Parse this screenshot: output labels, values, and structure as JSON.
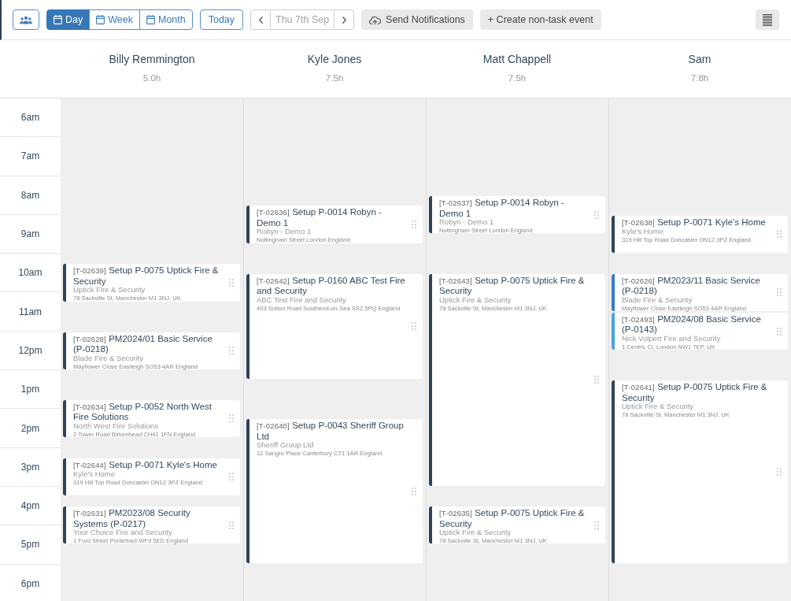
{
  "toolbar": {
    "view_tabs": [
      {
        "label": "Day",
        "selected": true
      },
      {
        "label": "Week",
        "selected": false
      },
      {
        "label": "Month",
        "selected": false
      }
    ],
    "today_button": "Today",
    "date": "Thu 7th Sep",
    "send_notifications_button": "Send Notifications",
    "create_event_button": "+ Create non-task event"
  },
  "time_slots": [
    "6am",
    "7am",
    "8am",
    "9am",
    "10am",
    "11am",
    "12pm",
    "1pm",
    "2pm",
    "3pm",
    "4pm",
    "5pm",
    "6pm"
  ],
  "resources": [
    {
      "name": "Billy Remmington",
      "hours": "5.0h",
      "events": [
        {
          "ref": "[T-02639]",
          "title": "Setup P-0075 Uptick Fire & Security",
          "client": "Uptick Fire & Security",
          "address": "78 Sackville St, Manchester M1 3NJ, UK",
          "color": "#2f4358"
        },
        {
          "ref": "[T-02628]",
          "title": "PM2024/01 Basic Service (P-0218)",
          "client": "Blade Fire & Security",
          "address": "Mayflower Close Eastleigh SO53 4AR England",
          "color": "#2f4358"
        },
        {
          "ref": "[T-02634]",
          "title": "Setup P-0052 North West Fire Solutions",
          "client": "North West Fire Solutions",
          "address": "2 Tower Road Birkenhead CH41 1FN England",
          "color": "#2f4358"
        },
        {
          "ref": "[T-02644]",
          "title": "Setup P-0071 Kyle's Home",
          "client": "Kyle's Home",
          "address": "319 Hill Top Road Doncaster DN12 3PZ England",
          "color": "#2f4358"
        },
        {
          "ref": "[T-02631]",
          "title": "PM2023/08 Security Systems (P-0217)",
          "client": "Your Choice Fire and Security",
          "address": "1 Ford Street Pontefract WF9 5ED England",
          "color": "#2f4358"
        }
      ]
    },
    {
      "name": "Kyle Jones",
      "hours": "7.5h",
      "events": [
        {
          "ref": "[T-02636]",
          "title": "Setup P-0014 Robyn - Demo 1",
          "client": "Robyn - Demo 1",
          "address": "Nottingham Street London England",
          "color": "#2f4358"
        },
        {
          "ref": "[T-02642]",
          "title": "Setup P-0160 ABC Test Fire and Security",
          "client": "ABC Test Fire and Security",
          "address": "403 Sutton Road Southend-on-Sea SS2 5PQ England",
          "color": "#2f4358"
        },
        {
          "ref": "[T-02640]",
          "title": "Setup P-0043 Sheriff Group Ltd",
          "client": "Sheriff Group Ltd",
          "address": "12 Sangro Place Canterbury CT1 1AR England",
          "color": "#2f4358"
        }
      ]
    },
    {
      "name": "Matt Chappell",
      "hours": "7.5h",
      "events": [
        {
          "ref": "[T-02637]",
          "title": "Setup P-0014 Robyn - Demo 1",
          "client": "Robyn - Demo 1",
          "address": "Nottingham Street London England",
          "color": "#2f4358"
        },
        {
          "ref": "[T-02643]",
          "title": "Setup P-0075 Uptick Fire & Security",
          "client": "Uptick Fire & Security",
          "address": "78 Sackville St, Manchester M1 3NJ, UK",
          "color": "#2f4358"
        },
        {
          "ref": "[T-02635]",
          "title": "Setup P-0075 Uptick Fire & Security",
          "client": "Uptick Fire & Security",
          "address": "78 Sackville St, Manchester M1 3NJ, UK",
          "color": "#2f4358"
        }
      ]
    },
    {
      "name": "Sam",
      "hours": "7.8h",
      "events": [
        {
          "ref": "[T-02638]",
          "title": "Setup P-0071 Kyle's Home",
          "client": "Kyle's Home",
          "address": "319 Hill Top Road Doncaster DN12 3PZ England",
          "color": "#2f4358"
        },
        {
          "ref": "[T-02626]",
          "title": "PM2023/11 Basic Service (P-0218)",
          "client": "Blade Fire & Security",
          "address": "Mayflower Close Eastleigh SO53 4AR England",
          "color": "#3a78d4"
        },
        {
          "ref": "[T-02493]",
          "title": "PM2024/08 Basic Service (P-0143)",
          "client": "Nick Volpert Fire and Security",
          "address": "1 Centric Cl, London NW1 7EP, UK",
          "color": "#4aa3e0"
        },
        {
          "ref": "[T-02641]",
          "title": "Setup P-0075 Uptick Fire & Security",
          "client": "Uptick Fire & Security",
          "address": "78 Sackville St, Manchester M1 3NJ, UK",
          "color": "#2f4358"
        }
      ]
    }
  ]
}
